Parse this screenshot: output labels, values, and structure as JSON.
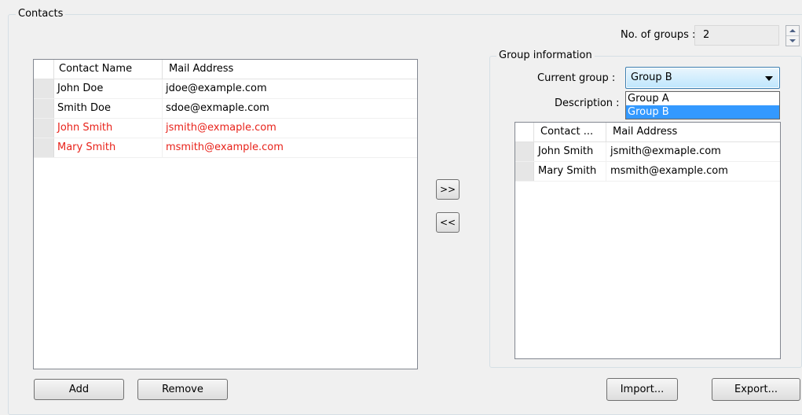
{
  "contacts_group": {
    "title": "Contacts",
    "columns": [
      "Contact Name",
      "Mail Address"
    ],
    "rows": [
      {
        "name": "John Doe",
        "mail": "jdoe@example.com",
        "highlight": false
      },
      {
        "name": "Smith Doe",
        "mail": "sdoe@exmaple.com",
        "highlight": false
      },
      {
        "name": "John Smith",
        "mail": "jsmith@exmaple.com",
        "highlight": true
      },
      {
        "name": "Mary Smith",
        "mail": "msmith@example.com",
        "highlight": true
      }
    ],
    "highlight_color": "#e8221a",
    "add_label": "Add",
    "remove_label": "Remove"
  },
  "transfer": {
    "add_label": ">>",
    "remove_label": "<<"
  },
  "groups": {
    "count_label": "No. of groups :",
    "count_value": "2"
  },
  "group_info": {
    "title": "Group information",
    "current_group_label": "Current group :",
    "current_group_value": "Group B",
    "dropdown_options": [
      "Group A",
      "Group B"
    ],
    "dropdown_selected_index": 1,
    "selection_color": "#3399ff",
    "description_label": "Description :",
    "columns": [
      "Contact ...",
      "Mail Address"
    ],
    "rows": [
      {
        "name": "John Smith",
        "mail": "jsmith@exmaple.com"
      },
      {
        "name": "Mary Smith",
        "mail": "msmith@example.com"
      }
    ]
  },
  "footer": {
    "import_label": "Import...",
    "export_label": "Export..."
  }
}
